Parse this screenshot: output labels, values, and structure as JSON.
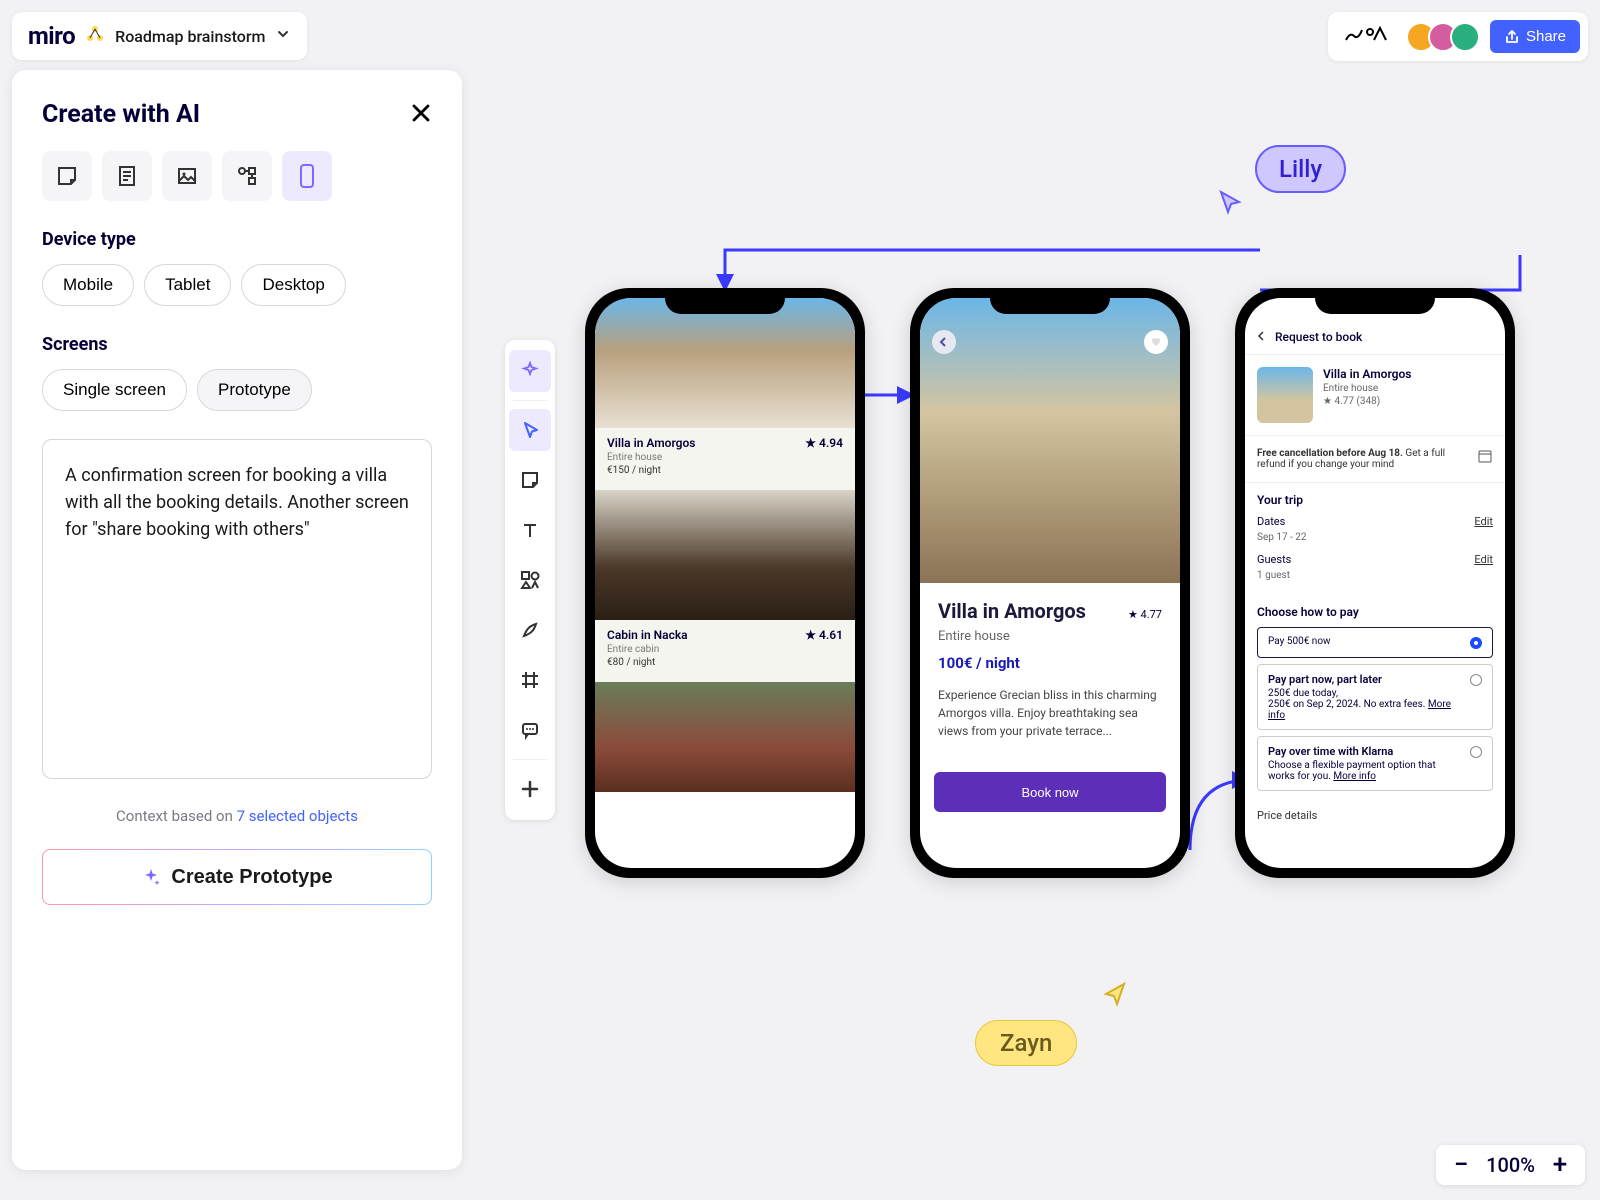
{
  "header": {
    "logo": "miro",
    "board_title": "Roadmap brainstorm",
    "share_label": "Share"
  },
  "panel": {
    "title": "Create with AI",
    "device_label": "Device type",
    "devices": {
      "mobile": "Mobile",
      "tablet": "Tablet",
      "desktop": "Desktop"
    },
    "screens_label": "Screens",
    "screens": {
      "single": "Single screen",
      "prototype": "Prototype"
    },
    "prompt_text": "A confirmation screen for booking a villa with all the booking details. Another screen for \"share booking with others\"",
    "context_prefix": "Context based on ",
    "context_link": "7 selected objects",
    "create_label": "Create Prototype"
  },
  "collaborators": {
    "lilly": "Lilly",
    "zayn": "Zayn"
  },
  "phone1": {
    "l1": {
      "title": "Villa in Amorgos",
      "rating": "★ 4.94",
      "sub": "Entire house",
      "price": "€150  / night"
    },
    "l2": {
      "title": "Cabin in Nacka",
      "rating": "★ 4.61",
      "sub": "Entire cabin",
      "price": "€80  / night"
    }
  },
  "phone2": {
    "title": "Villa in Amorgos",
    "rating": "★ 4.77",
    "sub": "Entire house",
    "price": "100€  / night",
    "desc": "Experience Grecian bliss in this charming Amorgos villa. Enjoy breathtaking sea views from your private terrace...",
    "book_label": "Book now"
  },
  "phone3": {
    "head": "Request to book",
    "sum_title": "Villa in Amorgos",
    "sum_sub": "Entire house",
    "sum_rating": "★ 4.77 (348)",
    "cancel_bold": "Free cancellation before Aug 18.",
    "cancel_rest": " Get a full refund if you change your mind",
    "trip_label": "Your trip",
    "dates_label": "Dates",
    "dates_val": "Sep 17 - 22",
    "guests_label": "Guests",
    "guests_val": "1 guest",
    "edit": "Edit",
    "pay_label": "Choose how to pay",
    "pay1": "Pay 500€ now",
    "pay2_title": "Pay part now, part later",
    "pay2_line1": "250€ due today,",
    "pay2_line2": "250€ on Sep 2, 2024. No extra fees. ",
    "pay3_title": "Pay over time with Klarna",
    "pay3_desc": "Choose a flexible payment option that works for you. ",
    "more": "More info",
    "price_label": "Price details"
  },
  "zoom": {
    "level": "100%"
  }
}
